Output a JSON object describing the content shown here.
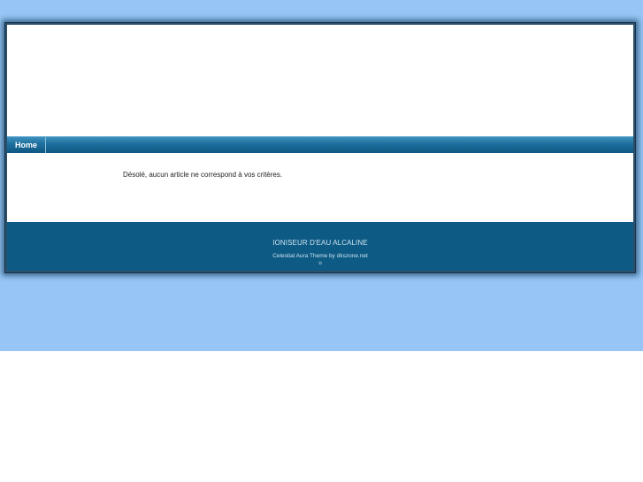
{
  "nav": {
    "items": [
      {
        "label": "Home"
      }
    ]
  },
  "content": {
    "message": "Désolé, aucun article ne correspond à vos critères."
  },
  "footer": {
    "title": "IONISEUR D'EAU ALCALINE",
    "credit": "Celestial Aura Theme by dkszone.net",
    "mark": "u"
  },
  "colors": {
    "background_sky": "#97c6f6",
    "nav_bar": "#1c6e9c",
    "footer": "#0d5a84",
    "page": "#ffffff"
  }
}
